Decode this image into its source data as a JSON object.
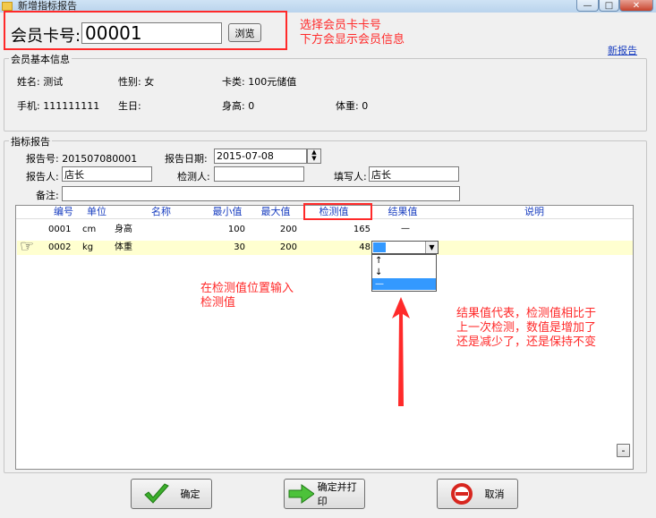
{
  "window": {
    "title": "新增指标报告",
    "min_glyph": "—",
    "max_glyph": "□",
    "close_glyph": "✕"
  },
  "card": {
    "label": "会员卡号:",
    "value": "00001",
    "browse_label": "浏览"
  },
  "new_report_link": "新报告",
  "member_info": {
    "group_title": "会员基本信息",
    "name_label": "姓名:",
    "name_value": "测试",
    "gender_label": "性别:",
    "gender_value": "女",
    "card_type_label": "卡类:",
    "card_type_value": "100元储值",
    "phone_label": "手机:",
    "phone_value": "111111111",
    "birthday_label": "生日:",
    "birthday_value": "",
    "height_label": "身高:",
    "height_value": "0",
    "weight_label": "体重:",
    "weight_value": "0"
  },
  "report": {
    "group_title": "指标报告",
    "report_no_label": "报告号:",
    "report_no_value": "201507080001",
    "date_label": "报告日期:",
    "date_value": "2015-07-08",
    "reporter_label": "报告人:",
    "reporter_value": "店长",
    "inspector_label": "检测人:",
    "inspector_value": "",
    "filler_label": "填写人:",
    "filler_value": "店长",
    "remark_label": "备注:",
    "remark_value": ""
  },
  "grid": {
    "headers": {
      "code": "编号",
      "unit": "单位",
      "name": "名称",
      "min": "最小值",
      "max": "最大值",
      "test": "检测值",
      "result": "结果值",
      "desc": "说明"
    },
    "rows": [
      {
        "code": "0001",
        "unit": "cm",
        "name": "身高",
        "min": "100",
        "max": "200",
        "test": "165",
        "result": "—",
        "desc": ""
      },
      {
        "code": "0002",
        "unit": "kg",
        "name": "体重",
        "min": "30",
        "max": "200",
        "test": "48",
        "result": "",
        "desc": ""
      }
    ],
    "row_pointer_glyph": "☞",
    "result_options": [
      "↑",
      "↓",
      "—"
    ],
    "dropdown_arrow": "▼",
    "scroll_button": "-"
  },
  "annotations": {
    "card_hint": [
      "选择会员卡卡号",
      "下方会显示会员信息"
    ],
    "input_hint": [
      "在检测值位置输入",
      "检测值"
    ],
    "result_hint": [
      "结果值代表，检测值相比于",
      "上一次检测，数值是增加了",
      "还是减少了，还是保持不变"
    ]
  },
  "buttons": {
    "confirm": "确定",
    "confirm_print": "确定并打印",
    "cancel": "取消"
  },
  "colors": {
    "annotation_red": "#ff2a2a",
    "header_blue": "#1a3fc0",
    "selected_row": "#ffffd0"
  }
}
